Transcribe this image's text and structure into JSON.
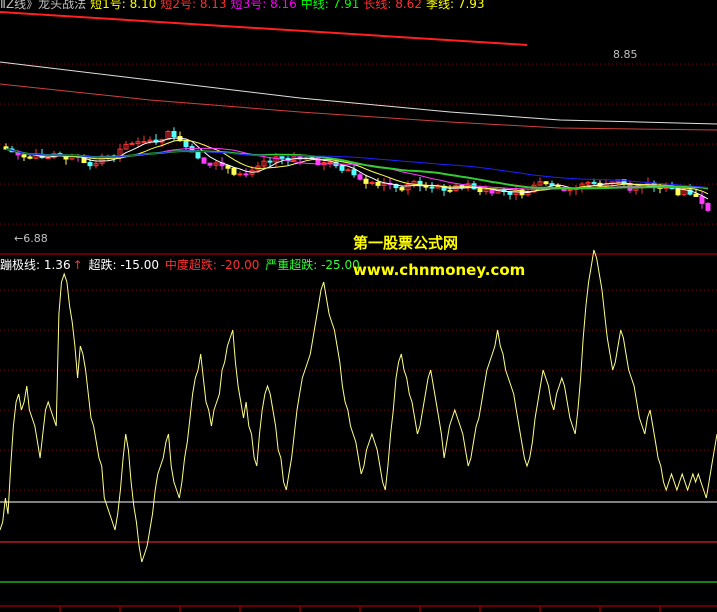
{
  "top_legend": [
    {
      "text": "ⅡZ线》龙头战法",
      "color": "#c0c0c0"
    },
    {
      "text": "短1号: 8.10",
      "color": "#ffff00"
    },
    {
      "text": "短2号: 8.13",
      "color": "#ff3030"
    },
    {
      "text": "短3号: 8.16",
      "color": "#ff00ff"
    },
    {
      "text": "中线: 7.91",
      "color": "#00ff00"
    },
    {
      "text": "长线: 8.62",
      "color": "#ff3030"
    },
    {
      "text": "季线: 7.93",
      "color": "#ffff00"
    }
  ],
  "price_labels": {
    "high": "8.85",
    "low": "6.88"
  },
  "indicator_legend": {
    "item1": "蹦极线: 1.36",
    "item2": "超跌: -15.00",
    "item3": "中度超跌: -20.00",
    "item4": "严重超跌: -25.00"
  },
  "watermark": {
    "line1": "第一股票公式网",
    "line2": "www.chnmoney.com"
  },
  "colors": {
    "up": "#ff3232",
    "down": "#54ffff",
    "magenta": "#ff3cff",
    "yellow": "#ffff54",
    "green": "#33cc33",
    "blue": "#2020ff",
    "white": "#ffffff",
    "grid": "#800000"
  },
  "chart_data": {
    "type": "line",
    "price_range": [
      6.5,
      8.95
    ],
    "indicator_series": {
      "name": "蹦极线",
      "values": [
        -30,
        -29,
        -26,
        -28,
        -22,
        -17,
        -14,
        -13,
        -15,
        -14,
        -12,
        -15,
        -16,
        -17,
        -19,
        -21,
        -18,
        -15,
        -14,
        -15,
        -16,
        -17,
        -3,
        1,
        2,
        1,
        -2,
        -4,
        -7,
        -11,
        -7,
        -8,
        -10,
        -13,
        -16,
        -17,
        -19,
        -21,
        -22,
        -26,
        -27,
        -28,
        -29,
        -30,
        -28,
        -25,
        -21,
        -18,
        -20,
        -24,
        -27,
        -29,
        -32,
        -34,
        -33,
        -32,
        -30,
        -28,
        -25,
        -23,
        -22,
        -21,
        -19,
        -18,
        -22,
        -24,
        -25,
        -26,
        -24,
        -21,
        -19,
        -16,
        -13,
        -11,
        -10,
        -8,
        -11,
        -14,
        -15,
        -17,
        -15,
        -14,
        -13,
        -10,
        -9,
        -7,
        -6,
        -5,
        -9,
        -12,
        -14,
        -16,
        -14,
        -17,
        -18,
        -21,
        -22,
        -18,
        -15,
        -13,
        -12,
        -13,
        -15,
        -17,
        -20,
        -21,
        -24,
        -25,
        -23,
        -21,
        -18,
        -15,
        -13,
        -11,
        -10,
        -9,
        -8,
        -6,
        -4,
        -2,
        0,
        1,
        -1,
        -3,
        -4,
        -5,
        -7,
        -9,
        -12,
        -14,
        -15,
        -17,
        -18,
        -19,
        -21,
        -23,
        -22,
        -20,
        -19,
        -18,
        -19,
        -20,
        -22,
        -24,
        -25,
        -22,
        -18,
        -15,
        -11,
        -9,
        -8,
        -10,
        -11,
        -13,
        -14,
        -16,
        -18,
        -17,
        -15,
        -13,
        -11,
        -10,
        -12,
        -14,
        -16,
        -18,
        -21,
        -19,
        -17,
        -16,
        -15,
        -16,
        -17,
        -18,
        -20,
        -22,
        -21,
        -19,
        -17,
        -16,
        -14,
        -12,
        -10,
        -9,
        -8,
        -7,
        -5,
        -7,
        -8,
        -10,
        -11,
        -12,
        -13,
        -15,
        -17,
        -19,
        -21,
        -22,
        -21,
        -19,
        -16,
        -14,
        -12,
        -10,
        -11,
        -12,
        -14,
        -15,
        -13,
        -12,
        -11,
        -12,
        -14,
        -16,
        -17,
        -18,
        -15,
        -11,
        -6,
        -2,
        1,
        3,
        5,
        4,
        2,
        0,
        -3,
        -6,
        -8,
        -10,
        -9,
        -7,
        -5,
        -6,
        -8,
        -10,
        -11,
        -12,
        -14,
        -16,
        -17,
        -18,
        -16,
        -15,
        -17,
        -19,
        -21,
        -22,
        -24,
        -25,
        -24,
        -23,
        -24,
        -25,
        -24,
        -23,
        -24,
        -25,
        -24,
        -23,
        -24,
        -23,
        -24,
        -25,
        -26,
        -24,
        -22,
        -20,
        -18
      ],
      "levels": [
        -15,
        -20,
        -25
      ]
    }
  }
}
